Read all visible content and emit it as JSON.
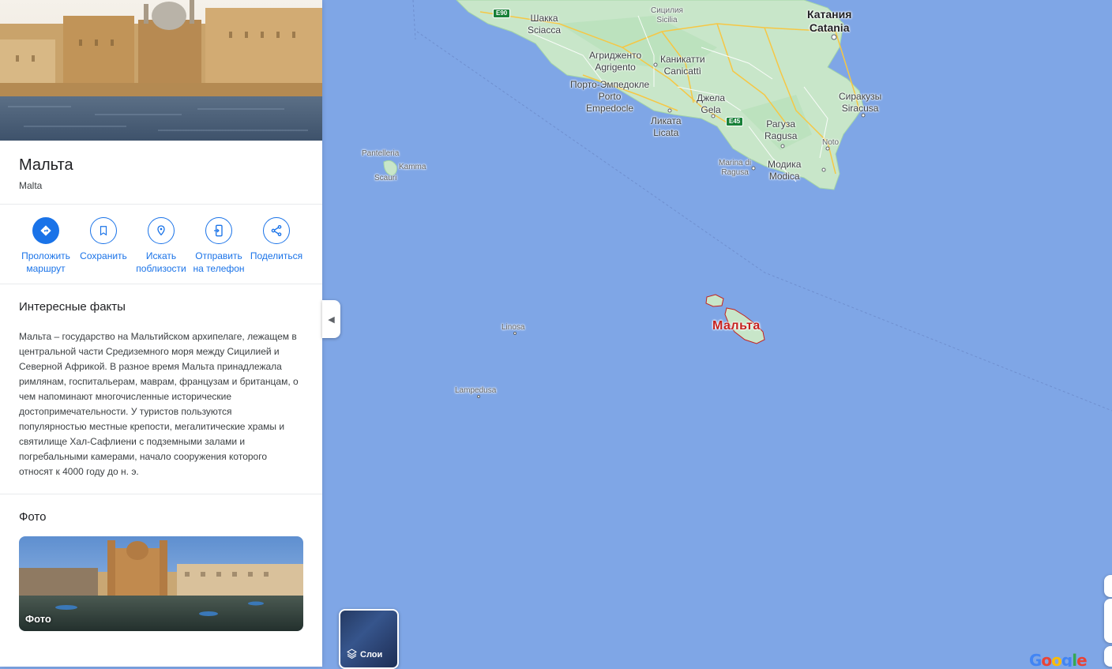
{
  "place": {
    "title": "Мальта",
    "subtitle": "Malta"
  },
  "actions": [
    {
      "label": "Проложить маршрут",
      "icon": "directions-icon"
    },
    {
      "label": "Сохранить",
      "icon": "bookmark-icon"
    },
    {
      "label": "Искать поблизости",
      "icon": "nearby-icon"
    },
    {
      "label": "Отправить на телефон",
      "icon": "send-to-phone-icon"
    },
    {
      "label": "Поделиться",
      "icon": "share-icon"
    }
  ],
  "facts": {
    "title": "Интересные факты",
    "text": "Мальта – государство на Мальтийском архипелаге, лежащем в центральной части Средиземного моря между Сицилией и Северной Африкой. В разное время Мальта принадлежала римлянам, госпитальерам, маврам, французам и британцам, о чем напоминают многочисленные исторические достопримечательности. У туристов пользуются популярностью местные крепости, мегалитические храмы и святилище Хал-Сафлиени с подземными залами и погребальными камерами, начало сооружения которого относят к 4000 году до н. э."
  },
  "photos": {
    "title": "Фото",
    "card_label": "Фото"
  },
  "map": {
    "labels": {
      "shakka": "Шакка",
      "sciacca": "Sciacca",
      "sicilia_ru": "Сицилия",
      "sicilia": "Sicilia",
      "catania_ru": "Катания",
      "catania": "Catania",
      "agrigento_ru": "Агридженто",
      "agrigento": "Agrigento",
      "canicatti_ru": "Каникатти",
      "canicatti": "Canicattì",
      "porto_ru": "Порто-Эмпедокле",
      "porto": "Porto",
      "empedocle": "Empedocle",
      "gela_ru": "Джела",
      "gela": "Gela",
      "licata_ru": "Ликата",
      "licata": "Licata",
      "siracusa_ru": "Сиракузы",
      "siracusa": "Siracusa",
      "ragusa_ru": "Рагуза",
      "ragusa": "Ragusa",
      "noto": "Noto",
      "marina1": "Marina di",
      "marina2": "Ragusa",
      "modica_ru": "Модика",
      "modica": "Modica",
      "pantelleria": "Pantelleria",
      "kamma": "Kamma",
      "scauri": "Scauri",
      "linosa": "Linosa",
      "lampedusa": "Lampedusa",
      "malta": "Мальта"
    },
    "shields": {
      "e90": "E90",
      "e45": "E45"
    },
    "layers_label": "Слои",
    "google_logo": "Google",
    "colors": {
      "water": "#7fa6e6",
      "land": "#c8e6c9",
      "roads": "#f6c744",
      "highlight": "#c5221f"
    }
  }
}
